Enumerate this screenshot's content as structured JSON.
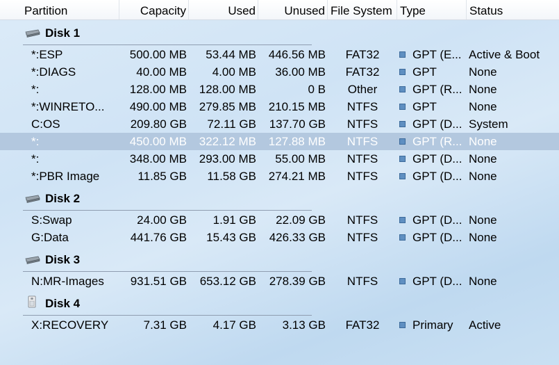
{
  "columns": {
    "partition": "Partition",
    "capacity": "Capacity",
    "used": "Used",
    "unused": "Unused",
    "file_system": "File System",
    "type": "Type",
    "status": "Status"
  },
  "disks": [
    {
      "name": "Disk 1",
      "icon": "hard-drive-icon",
      "partitions": [
        {
          "partition": "*:ESP",
          "capacity": "500.00 MB",
          "used": "53.44 MB",
          "unused": "446.56 MB",
          "fs": "FAT32",
          "type": "GPT (E...",
          "status": "Active & Boot",
          "selected": false
        },
        {
          "partition": "*:DIAGS",
          "capacity": "40.00 MB",
          "used": "4.00 MB",
          "unused": "36.00 MB",
          "fs": "FAT32",
          "type": "GPT",
          "status": "None",
          "selected": false
        },
        {
          "partition": "*:",
          "capacity": "128.00 MB",
          "used": "128.00 MB",
          "unused": "0 B",
          "fs": "Other",
          "type": "GPT (R...",
          "status": "None",
          "selected": false
        },
        {
          "partition": "*:WINRETO...",
          "capacity": "490.00 MB",
          "used": "279.85 MB",
          "unused": "210.15 MB",
          "fs": "NTFS",
          "type": "GPT",
          "status": "None",
          "selected": false
        },
        {
          "partition": "C:OS",
          "capacity": "209.80 GB",
          "used": "72.11 GB",
          "unused": "137.70 GB",
          "fs": "NTFS",
          "type": "GPT (D...",
          "status": "System",
          "selected": false
        },
        {
          "partition": "*:",
          "capacity": "450.00 MB",
          "used": "322.12 MB",
          "unused": "127.88 MB",
          "fs": "NTFS",
          "type": "GPT (R...",
          "status": "None",
          "selected": true
        },
        {
          "partition": "*:",
          "capacity": "348.00 MB",
          "used": "293.00 MB",
          "unused": "55.00 MB",
          "fs": "NTFS",
          "type": "GPT (D...",
          "status": "None",
          "selected": false
        },
        {
          "partition": "*:PBR Image",
          "capacity": "11.85 GB",
          "used": "11.58 GB",
          "unused": "274.21 MB",
          "fs": "NTFS",
          "type": "GPT (D...",
          "status": "None",
          "selected": false
        }
      ]
    },
    {
      "name": "Disk 2",
      "icon": "hard-drive-icon",
      "partitions": [
        {
          "partition": "S:Swap",
          "capacity": "24.00 GB",
          "used": "1.91 GB",
          "unused": "22.09 GB",
          "fs": "NTFS",
          "type": "GPT (D...",
          "status": "None",
          "selected": false
        },
        {
          "partition": "G:Data",
          "capacity": "441.76 GB",
          "used": "15.43 GB",
          "unused": "426.33 GB",
          "fs": "NTFS",
          "type": "GPT (D...",
          "status": "None",
          "selected": false
        }
      ]
    },
    {
      "name": "Disk 3",
      "icon": "hard-drive-icon",
      "partitions": [
        {
          "partition": "N:MR-Images",
          "capacity": "931.51 GB",
          "used": "653.12 GB",
          "unused": "278.39 GB",
          "fs": "NTFS",
          "type": "GPT (D...",
          "status": "None",
          "selected": false
        }
      ]
    },
    {
      "name": "Disk 4",
      "icon": "usb-drive-icon",
      "partitions": [
        {
          "partition": "X:RECOVERY",
          "capacity": "7.31 GB",
          "used": "4.17 GB",
          "unused": "3.13 GB",
          "fs": "FAT32",
          "type": "Primary",
          "status": "Active",
          "selected": false
        }
      ]
    }
  ],
  "colors": {
    "selection": "#b3c8df",
    "type_square": "#5f8fc1"
  }
}
